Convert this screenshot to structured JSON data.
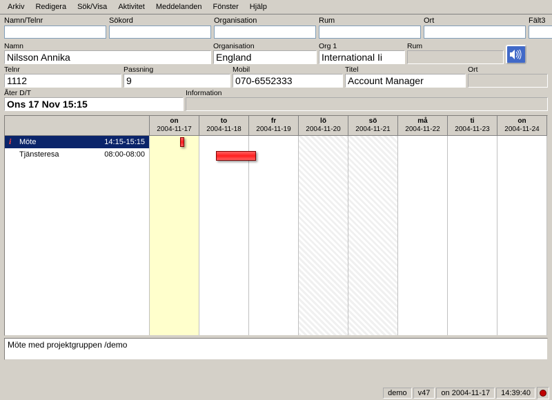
{
  "menu": [
    "Arkiv",
    "Redigera",
    "Sök/Visa",
    "Aktivitet",
    "Meddelanden",
    "Fönster",
    "Hjälp"
  ],
  "search": {
    "labels": [
      "Namn/Telnr",
      "Sökord",
      "Organisation",
      "Rum",
      "Ort",
      "Fält3"
    ]
  },
  "detail": {
    "namn_label": "Namn",
    "namn": "Nilsson Annika",
    "org_label": "Organisation",
    "org": "England",
    "org1_label": "Org 1",
    "org1": "International Ii",
    "rum_label": "Rum",
    "rum": "",
    "tel_label": "Telnr",
    "tel": "1112",
    "pass_label": "Passning",
    "pass": "9",
    "mobil_label": "Mobil",
    "mobil": "070-6552333",
    "titel_label": "Titel",
    "titel": "Account Manager",
    "ort_label": "Ort",
    "ort": "",
    "ater_label": "Åter D/T",
    "ater": "Ons 17 Nov 15:15",
    "info_label": "Information",
    "info": ""
  },
  "calendar": {
    "days": [
      {
        "wd": "on",
        "date": "2004-11-17",
        "today": true
      },
      {
        "wd": "to",
        "date": "2004-11-18"
      },
      {
        "wd": "fr",
        "date": "2004-11-19"
      },
      {
        "wd": "lö",
        "date": "2004-11-20",
        "weekend": true
      },
      {
        "wd": "sö",
        "date": "2004-11-21",
        "weekend": true
      },
      {
        "wd": "må",
        "date": "2004-11-22"
      },
      {
        "wd": "ti",
        "date": "2004-11-23"
      },
      {
        "wd": "on",
        "date": "2004-11-24"
      }
    ],
    "rows": [
      {
        "type": "Möte",
        "time": "14:15-15:15",
        "selected": true,
        "icon": true
      },
      {
        "type": "Tjänsteresa",
        "time": "08:00-08:00"
      }
    ]
  },
  "note": "Möte med projektgruppen /demo",
  "status": {
    "user": "demo",
    "week": "v47",
    "day": "on 2004-11-17",
    "time": "14:39:40"
  }
}
